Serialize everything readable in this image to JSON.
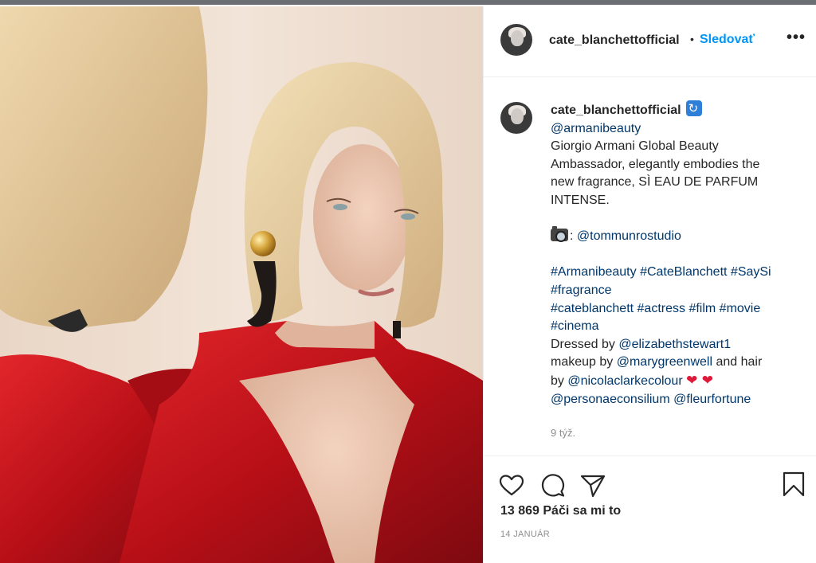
{
  "post": {
    "username": "cate_blanchettofficial",
    "separator": "•",
    "follow_label": "Sledovať",
    "more_label": "•••",
    "image_alt": "Portrait photo of a woman with a blonde bob wearing a red dress and gold earrings, facing a mirror"
  },
  "caption": {
    "username": "cate_blanchettofficial",
    "verified_icon": "verified-badge-icon",
    "mention_brand": "@armanibeauty",
    "body_lines": [
      "Giorgio Armani Global Beauty",
      "Ambassador, elegantly embodies the",
      "new fragrance, SÌ EAU DE PARFUM",
      "INTENSE."
    ],
    "camera_icon": "camera-emoji-icon",
    "photo_credit_prefix": ": ",
    "photo_credit": "@tommunrostudio",
    "hashtags_line1": "#Armanibeauty #CateBlanchett #SaySi",
    "hashtags_line2": "#fragrance",
    "hashtags_line3": "#cateblanchett #actress #film #movie",
    "hashtags_line4": "#cinema",
    "dressed_prefix": "Dressed by ",
    "dressed_by": "@elizabethstewart1",
    "makeup_prefix": "makeup by ",
    "makeup_by": "@marygreenwell",
    "hair_suffix": " and hair",
    "hair_prefix": "by ",
    "hair_by": "@nicolaclarkecolour",
    "hearts": "❤ ❤",
    "mention_persona": "@personaeconsilium",
    "mention_fleur": "@fleurfortune",
    "time_ago": "9 týž."
  },
  "actions": {
    "like_icon": "heart-outline-icon",
    "comment_icon": "speech-bubble-icon",
    "share_icon": "paper-plane-icon",
    "save_icon": "bookmark-icon",
    "likes_text": "13 869 Páči sa mi to",
    "date": "14 JANUÁR"
  }
}
